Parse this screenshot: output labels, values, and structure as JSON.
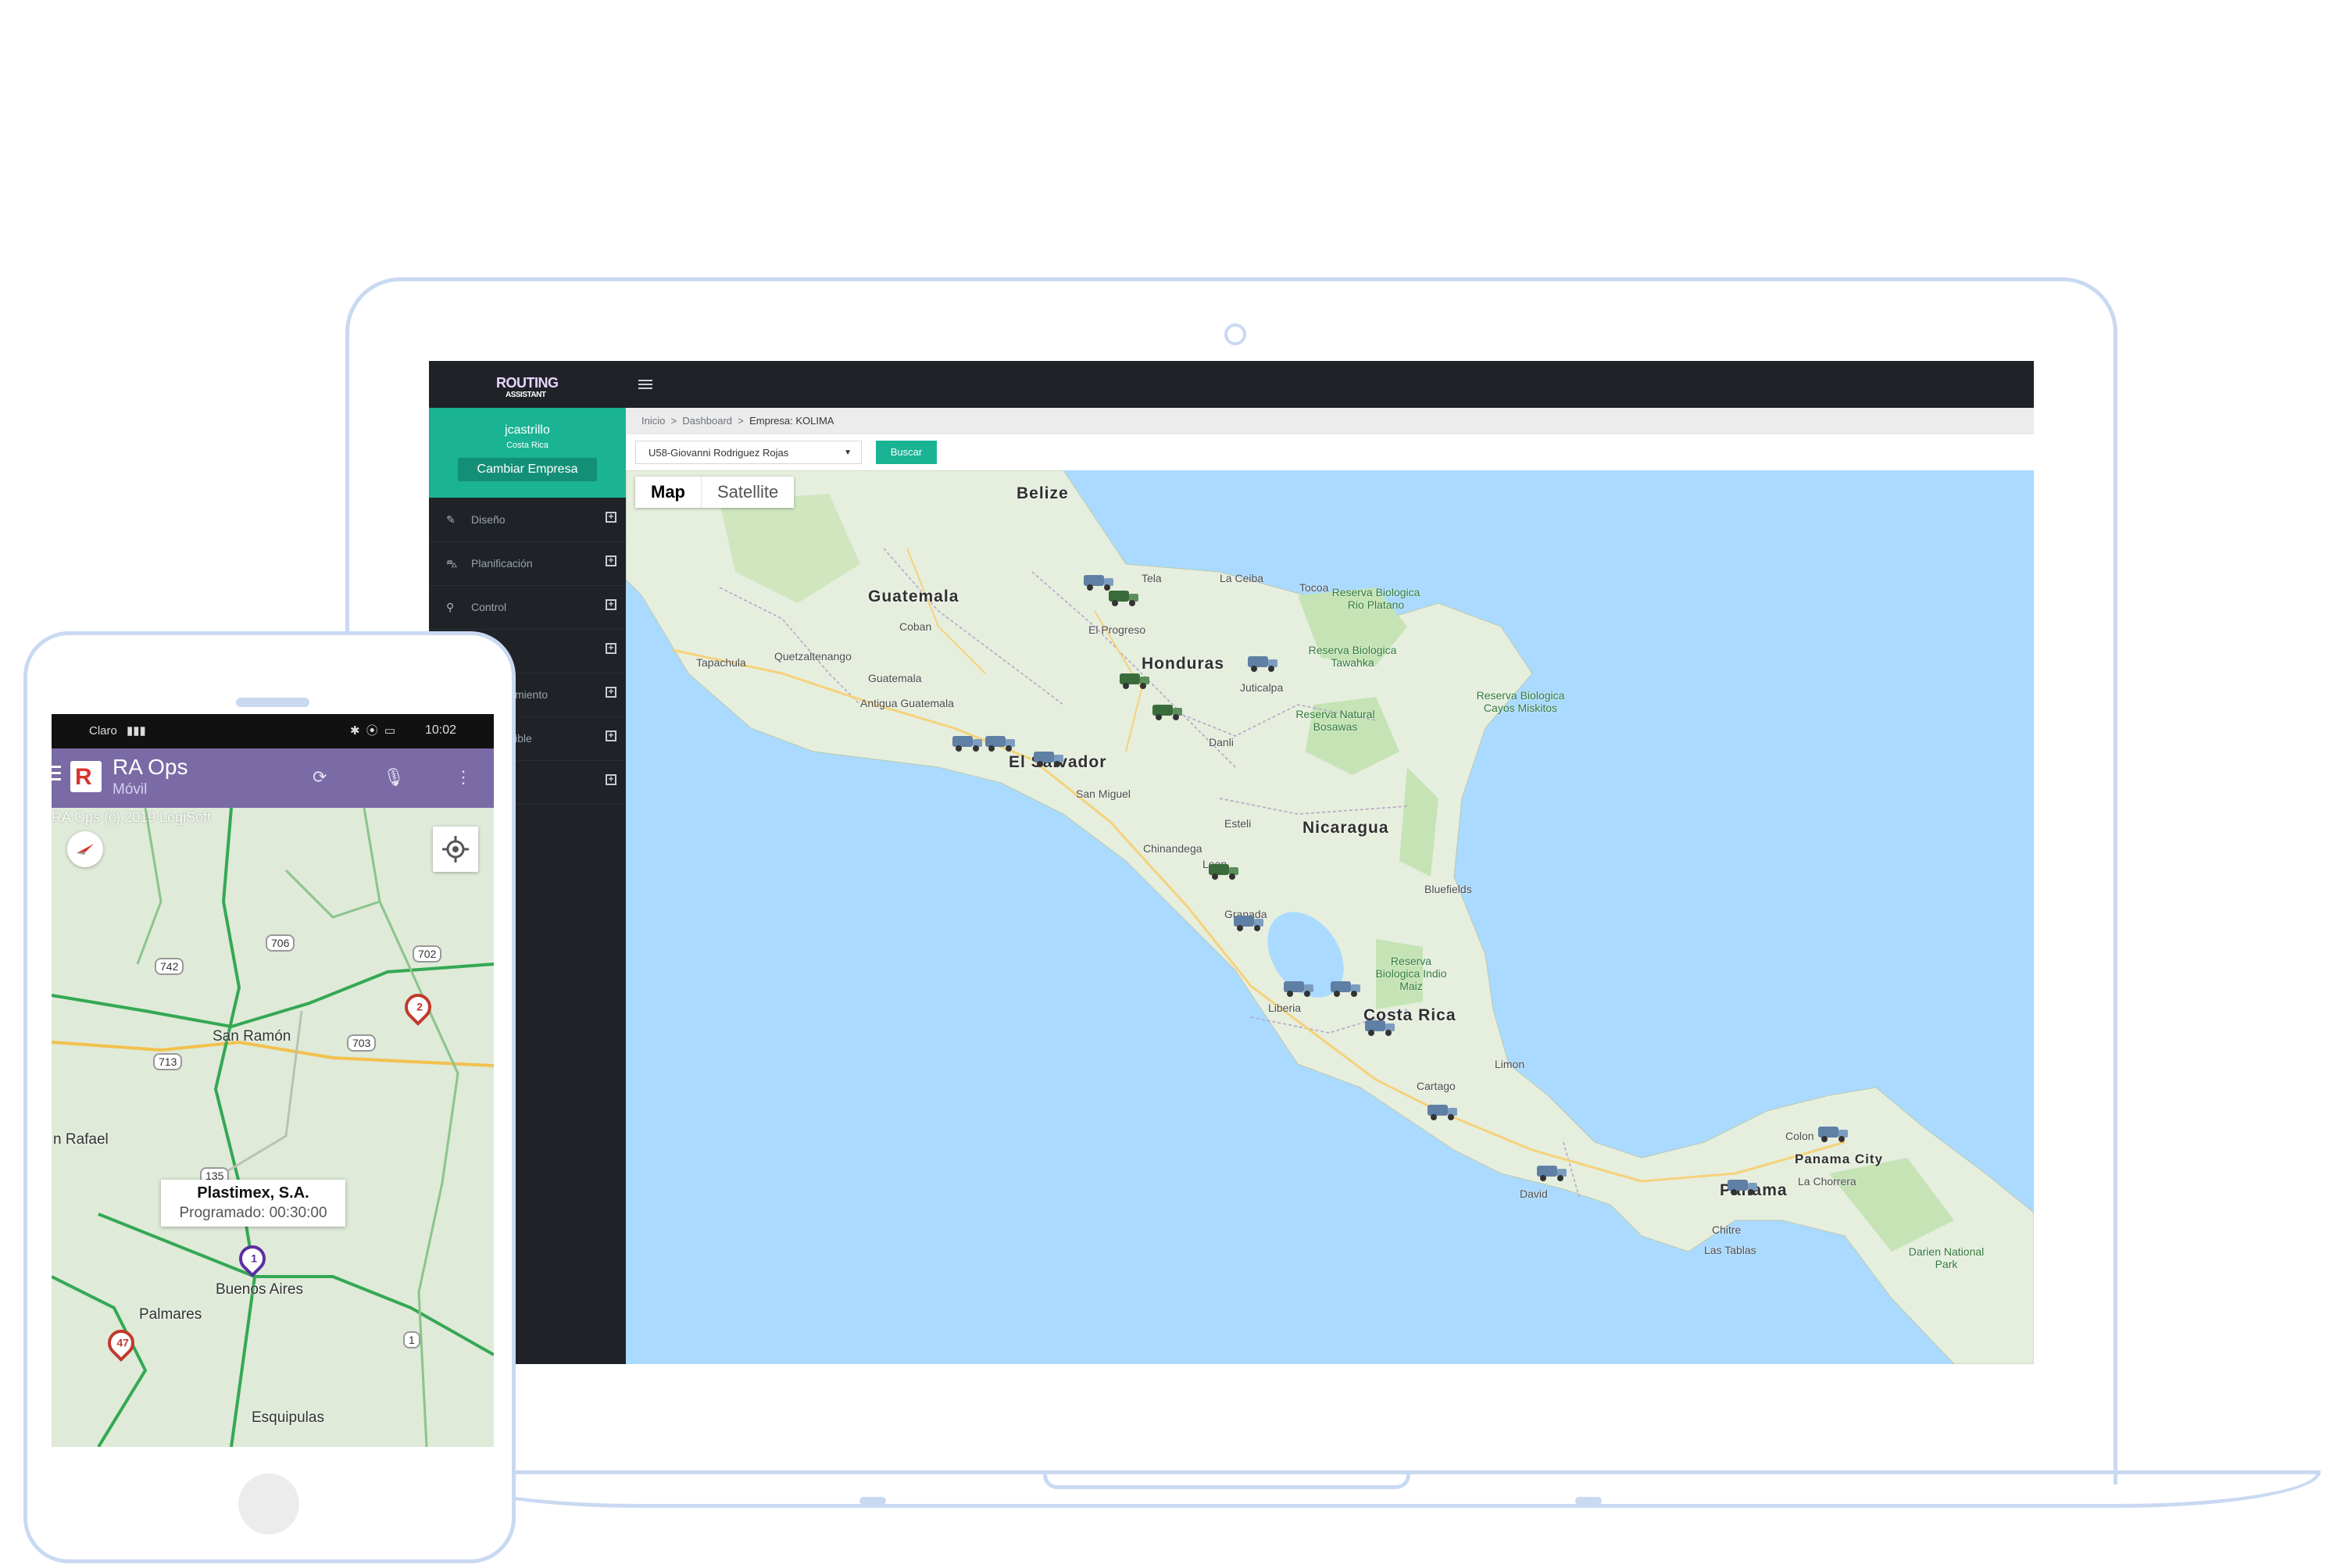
{
  "admin": {
    "logo_top": "ROUTING",
    "logo_bottom": "ASSISTANT",
    "user_name": "jcastrillo",
    "user_country": "Costa Rica",
    "change_company": "Cambiar Empresa",
    "nav_items": [
      {
        "label": "Diseño",
        "icon": "edit-icon"
      },
      {
        "label": "Planificación",
        "icon": "road-icon"
      },
      {
        "label": "Control",
        "icon": "map-pin-icon"
      },
      {
        "label": "",
        "icon": ""
      },
      {
        "label": "miento",
        "icon": ""
      },
      {
        "label": "ible",
        "icon": ""
      },
      {
        "label": "",
        "icon": ""
      }
    ],
    "breadcrumb": {
      "home": "Inicio",
      "dashboard": "Dashboard",
      "current": "Empresa: KOLIMA",
      "separator": ">"
    },
    "driver_select": "U58-Giovanni Rodriguez Rojas",
    "search_button": "Buscar",
    "map_type": {
      "map": "Map",
      "satellite": "Satellite"
    },
    "map_labels": {
      "countries": [
        "Belize",
        "Guatemala",
        "Honduras",
        "El Salvador",
        "Nicaragua",
        "Costa Rica",
        "Panama"
      ],
      "cities": [
        "Tapachula",
        "Quetzaltenango",
        "Guatemala",
        "Antigua Guatemala",
        "Coban",
        "El Progreso",
        "Tela",
        "La Ceiba",
        "Tocoa",
        "Juticalpa",
        "San Miguel",
        "Danli",
        "Esteli",
        "Chinandega",
        "Leon",
        "Granada",
        "Liberia",
        "Bluefields",
        "Limon",
        "Cartago",
        "David",
        "Colon",
        "Panama City",
        "La Chorrera",
        "Las Tablas",
        "Chitre"
      ],
      "reserves": [
        "Reserva Biologica Rio Platano",
        "Reserva Biologica Tawahka",
        "Reserva Natural Bosawas",
        "Reserva Biologica Cayos Miskitos",
        "Reserva Biologica Indio Maiz",
        "Darien National Park"
      ]
    }
  },
  "mobile": {
    "carrier": "Claro",
    "clock": "10:02",
    "app_title": "RA Ops",
    "app_subtitle": "Móvil",
    "copyright": "RA Ops (c) 2019 LogiSoft",
    "map_labels": [
      "San Ramón",
      "n Rafael",
      "Buenos Aires",
      "Palmares",
      "Esquipulas"
    ],
    "road_shields": [
      "742",
      "706",
      "702",
      "703",
      "713",
      "135",
      "1"
    ],
    "tooltip_title": "Plastimex, S.A.",
    "tooltip_sub": "Programado: 00:30:00",
    "pins": [
      {
        "label": "1",
        "color": "#5b2ea0"
      },
      {
        "label": "2",
        "color": "#c0392b"
      },
      {
        "label": "47",
        "color": "#c0392b"
      }
    ]
  },
  "colors": {
    "accent": "#1ab394",
    "dark": "#1f2328",
    "app_bar": "#7a6ba6",
    "water": "#aadaff",
    "land": "#e8efe0"
  }
}
